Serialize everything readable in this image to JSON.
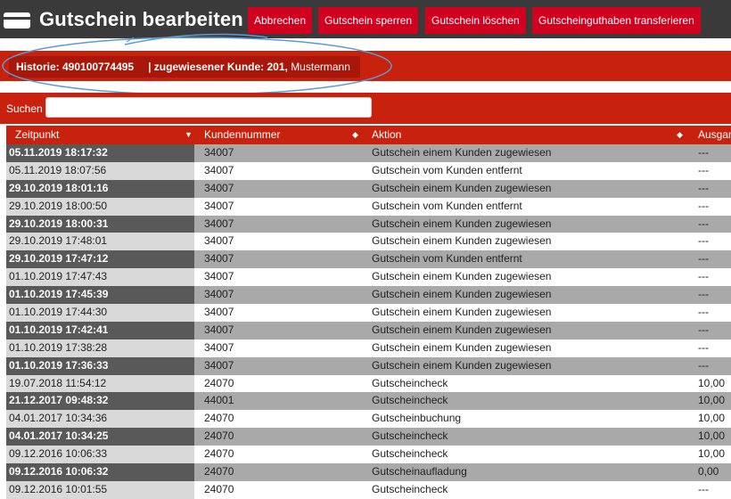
{
  "header": {
    "title": "Gutschein bearbeiten",
    "buttons": {
      "cancel": "Abbrechen",
      "lock": "Gutschein sperren",
      "delete": "Gutschein löschen",
      "transfer": "Gutscheinguthaben transferieren"
    }
  },
  "history": {
    "label": "Historie: 490100774495",
    "customer_label": "| zugewiesener Kunde: 201,",
    "customer_name": "Mustermann"
  },
  "search": {
    "label": "Suchen",
    "value": ""
  },
  "table": {
    "headers": {
      "zeitpunkt": "Zeitpunkt",
      "kundennummer": "Kundennummer",
      "aktion": "Aktion",
      "ausgabe": "Ausgan"
    },
    "rows": [
      {
        "zeit": "05.11.2019 18:17:32",
        "kunde": "34007",
        "aktion": "Gutschein einem Kunden zugewiesen",
        "ausgabe": "---"
      },
      {
        "zeit": "05.11.2019 18:07:56",
        "kunde": "34007",
        "aktion": "Gutschein vom Kunden entfernt",
        "ausgabe": "---"
      },
      {
        "zeit": "29.10.2019 18:01:16",
        "kunde": "34007",
        "aktion": "Gutschein einem Kunden zugewiesen",
        "ausgabe": "---"
      },
      {
        "zeit": "29.10.2019 18:00:50",
        "kunde": "34007",
        "aktion": "Gutschein vom Kunden entfernt",
        "ausgabe": "---"
      },
      {
        "zeit": "29.10.2019 18:00:31",
        "kunde": "34007",
        "aktion": "Gutschein einem Kunden zugewiesen",
        "ausgabe": "---"
      },
      {
        "zeit": "29.10.2019 17:48:01",
        "kunde": "34007",
        "aktion": "Gutschein einem Kunden zugewiesen",
        "ausgabe": "---"
      },
      {
        "zeit": "29.10.2019 17:47:12",
        "kunde": "34007",
        "aktion": "Gutschein vom Kunden entfernt",
        "ausgabe": "---"
      },
      {
        "zeit": "01.10.2019 17:47:43",
        "kunde": "34007",
        "aktion": "Gutschein einem Kunden zugewiesen",
        "ausgabe": "---"
      },
      {
        "zeit": "01.10.2019 17:45:39",
        "kunde": "34007",
        "aktion": "Gutschein einem Kunden zugewiesen",
        "ausgabe": "---"
      },
      {
        "zeit": "01.10.2019 17:44:30",
        "kunde": "34007",
        "aktion": "Gutschein einem Kunden zugewiesen",
        "ausgabe": "---"
      },
      {
        "zeit": "01.10.2019 17:42:41",
        "kunde": "34007",
        "aktion": "Gutschein einem Kunden zugewiesen",
        "ausgabe": "---"
      },
      {
        "zeit": "01.10.2019 17:38:28",
        "kunde": "34007",
        "aktion": "Gutschein einem Kunden zugewiesen",
        "ausgabe": "---"
      },
      {
        "zeit": "01.10.2019 17:36:33",
        "kunde": "34007",
        "aktion": "Gutschein einem Kunden zugewiesen",
        "ausgabe": "---"
      },
      {
        "zeit": "19.07.2018 11:54:12",
        "kunde": "24070",
        "aktion": "Gutscheincheck",
        "ausgabe": "10,00"
      },
      {
        "zeit": "21.12.2017 09:48:32",
        "kunde": "44001",
        "aktion": "Gutscheincheck",
        "ausgabe": "10,00"
      },
      {
        "zeit": "04.01.2017 10:34:36",
        "kunde": "24070",
        "aktion": "Gutscheinbuchung",
        "ausgabe": "10,00"
      },
      {
        "zeit": "04.01.2017 10:34:25",
        "kunde": "24070",
        "aktion": "Gutscheincheck",
        "ausgabe": "10,00"
      },
      {
        "zeit": "09.12.2016 10:06:33",
        "kunde": "24070",
        "aktion": "Gutscheincheck",
        "ausgabe": "10,00"
      },
      {
        "zeit": "09.12.2016 10:06:32",
        "kunde": "24070",
        "aktion": "Gutscheinaufladung",
        "ausgabe": "0,00"
      },
      {
        "zeit": "09.12.2016 10:01:55",
        "kunde": "24070",
        "aktion": "Gutscheincheck",
        "ausgabe": "---"
      }
    ]
  },
  "colors": {
    "topbar": "#3a3a3a",
    "button": "#d1001f",
    "bar": "#c8220f",
    "annotation": "#5b9bd5"
  }
}
